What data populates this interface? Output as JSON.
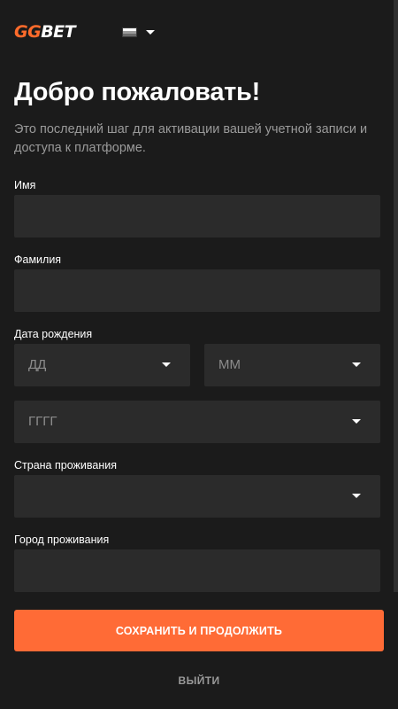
{
  "header": {
    "logo_part1": "GG",
    "logo_part2": "BET",
    "language_flag": "flag-icon"
  },
  "page": {
    "title": "Добро пожаловать!",
    "subtitle": "Это последний шаг для активации вашей учетной записи и доступа к платформе."
  },
  "form": {
    "first_name_label": "Имя",
    "first_name_value": "",
    "last_name_label": "Фамилия",
    "last_name_value": "",
    "birth_date_label": "Дата рождения",
    "day_placeholder": "ДД",
    "month_placeholder": "ММ",
    "year_placeholder": "ГГГГ",
    "country_label": "Страна проживания",
    "country_value": "",
    "city_label": "Город проживания",
    "city_value": ""
  },
  "actions": {
    "save_label": "СОХРАНИТЬ И ПРОДОЛЖИТЬ",
    "exit_label": "ВЫЙТИ"
  },
  "colors": {
    "background": "#1b1b1b",
    "field": "#2b2b2b",
    "accent": "#ff6b36",
    "muted_text": "#9a9a9a"
  }
}
